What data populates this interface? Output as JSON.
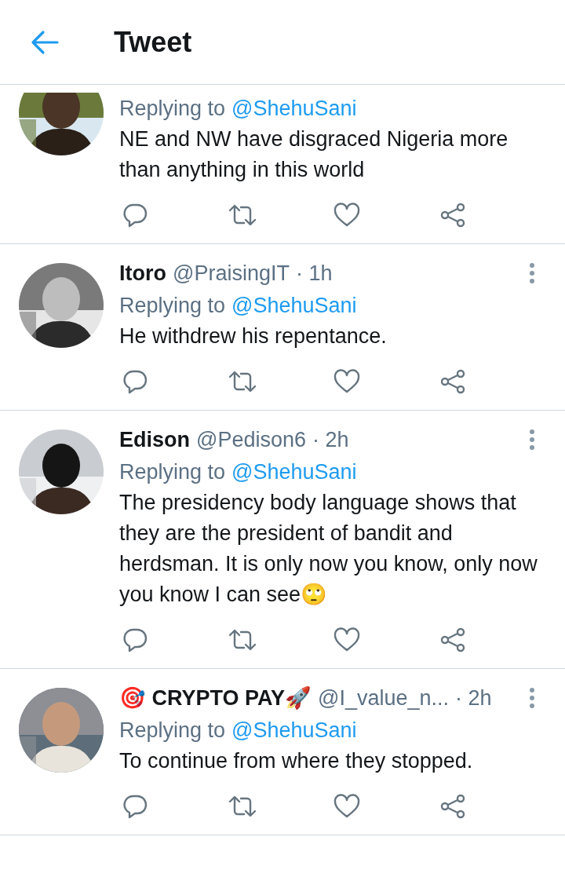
{
  "header": {
    "title": "Tweet"
  },
  "tweets": [
    {
      "replying_prefix": "Replying to",
      "replying_handle": "@ShehuSani",
      "text": "NE and NW have disgraced Nigeria more than anything in this world"
    },
    {
      "name": "Itoro",
      "handle": "@PraisingIT",
      "time": "· 1h",
      "replying_prefix": "Replying to",
      "replying_handle": "@ShehuSani",
      "text": "He withdrew his repentance."
    },
    {
      "name": "Edison",
      "handle": "@Pedison6",
      "time": "· 2h",
      "replying_prefix": "Replying to",
      "replying_handle": "@ShehuSani",
      "text": "The presidency body language shows that they are the president of bandit and herdsman. It is only now you know, only now you know I can see🙄"
    },
    {
      "name": "🎯 CRYPTO PAY🚀",
      "handle": "@I_value_n...",
      "time": "· 2h",
      "replying_prefix": "Replying to",
      "replying_handle": "@ShehuSani",
      "text": "To continue from where they stopped."
    }
  ]
}
